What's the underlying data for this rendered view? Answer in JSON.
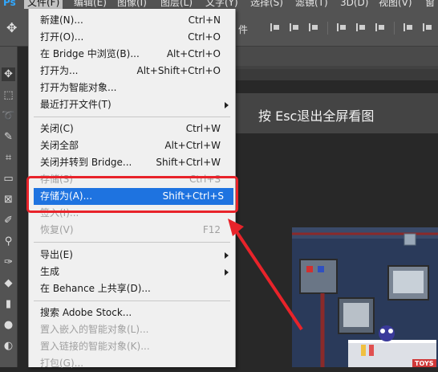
{
  "app": {
    "logo": "Ps",
    "accent_color": "#31a8ff"
  },
  "menubar": {
    "items": [
      "文件(F)",
      "编辑(E)",
      "图像(I)",
      "图层(L)",
      "文字(Y)",
      "选择(S)",
      "滤镜(T)",
      "3D(D)",
      "视图(V)",
      "窗"
    ]
  },
  "options_bar": {
    "partial_label": "件"
  },
  "toast": {
    "message": "按 Esc退出全屏看图"
  },
  "file_menu": {
    "items": [
      {
        "label": "新建(N)...",
        "shortcut": "Ctrl+N"
      },
      {
        "label": "打开(O)...",
        "shortcut": "Ctrl+O"
      },
      {
        "label": "在 Bridge 中浏览(B)...",
        "shortcut": "Alt+Ctrl+O"
      },
      {
        "label": "打开为...",
        "shortcut": "Alt+Shift+Ctrl+O"
      },
      {
        "label": "打开为智能对象...",
        "shortcut": ""
      },
      {
        "label": "最近打开文件(T)",
        "shortcut": ""
      },
      {
        "label": "关闭(C)",
        "shortcut": "Ctrl+W"
      },
      {
        "label": "关闭全部",
        "shortcut": "Alt+Ctrl+W"
      },
      {
        "label": "关闭并转到 Bridge...",
        "shortcut": "Shift+Ctrl+W"
      },
      {
        "label": "存储(S)",
        "shortcut": "Ctrl+S"
      },
      {
        "label": "存储为(A)...",
        "shortcut": "Shift+Ctrl+S"
      },
      {
        "label": "签入(I)...",
        "shortcut": ""
      },
      {
        "label": "恢复(V)",
        "shortcut": "F12"
      },
      {
        "label": "导出(E)",
        "shortcut": ""
      },
      {
        "label": "生成",
        "shortcut": ""
      },
      {
        "label": "在 Behance 上共享(D)...",
        "shortcut": ""
      },
      {
        "label": "搜索 Adobe Stock...",
        "shortcut": ""
      },
      {
        "label": "置入嵌入的智能对象(L)...",
        "shortcut": ""
      },
      {
        "label": "置入链接的智能对象(K)...",
        "shortcut": ""
      },
      {
        "label": "打包(G)...",
        "shortcut": ""
      }
    ],
    "highlight_color": "#1e73e0",
    "annotation_color": "#e8232a"
  },
  "artwork": {
    "sign_text": "TOYS"
  }
}
